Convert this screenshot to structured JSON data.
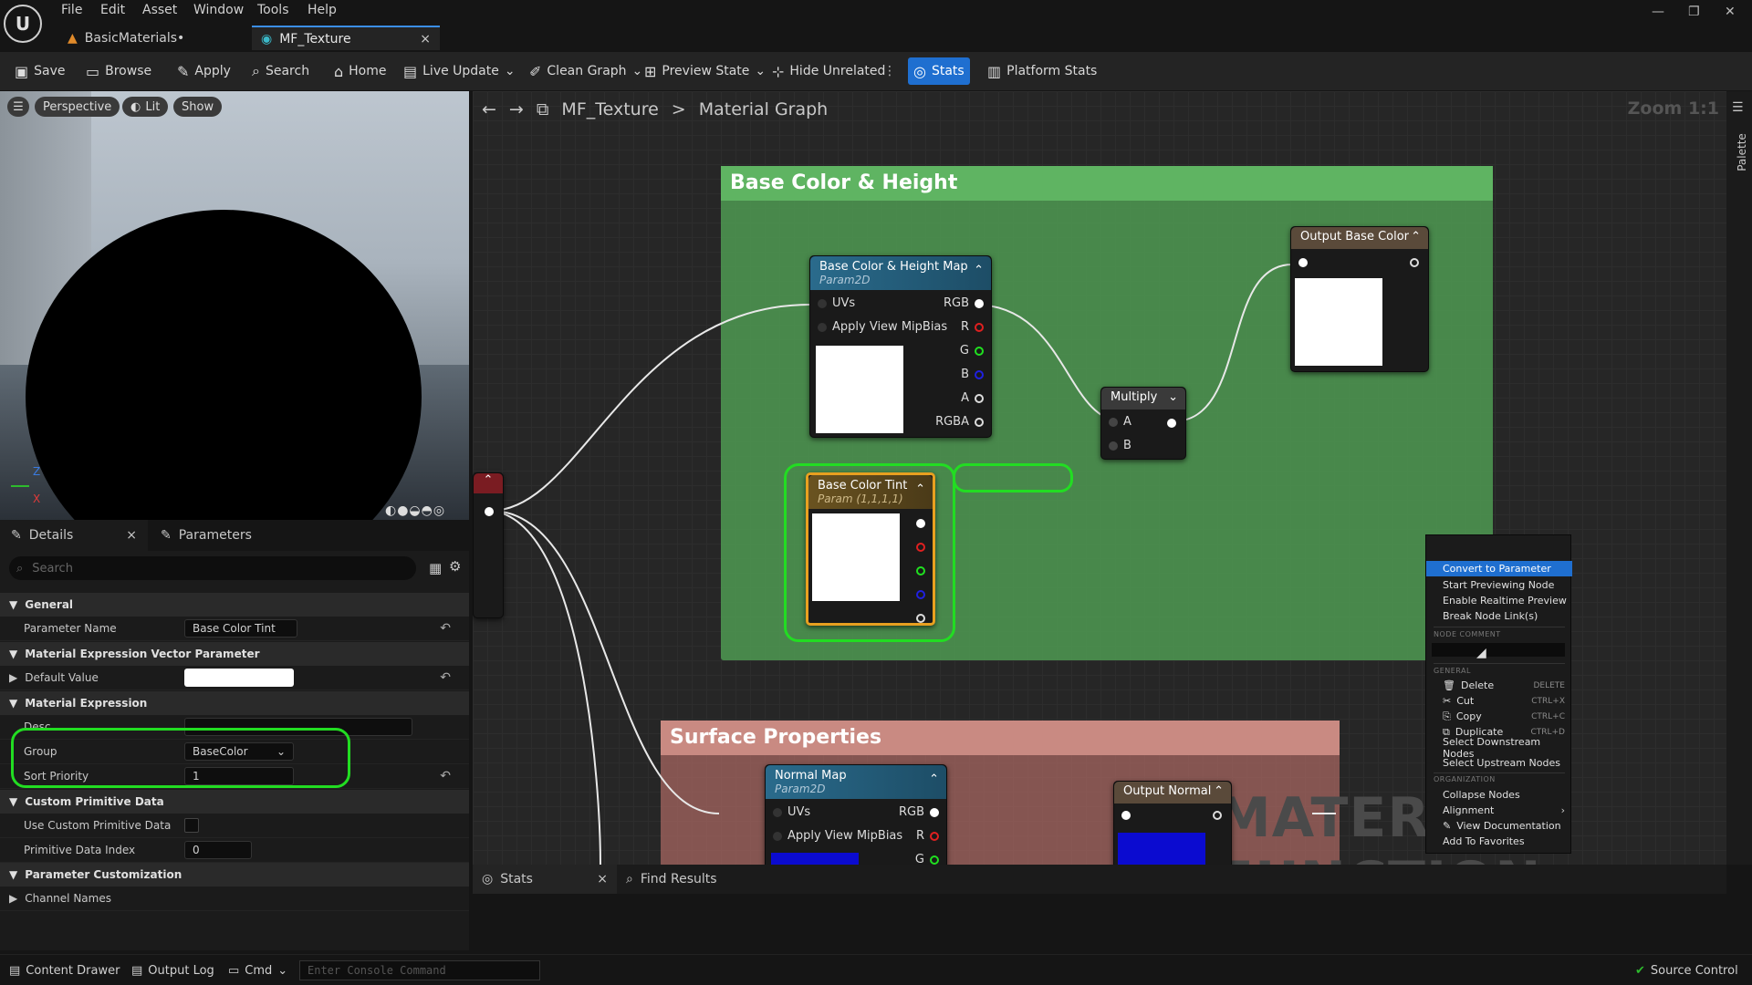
{
  "menu": [
    "File",
    "Edit",
    "Asset",
    "Window",
    "Tools",
    "Help"
  ],
  "tabs": {
    "t1": "BasicMaterials•",
    "t2": "MF_Texture",
    "close": "×"
  },
  "window": {
    "min": "—",
    "max": "❐",
    "close": "✕"
  },
  "toolbar": {
    "save": "Save",
    "browse": "Browse",
    "apply": "Apply",
    "search": "Search",
    "home": "Home",
    "live_update": "Live Update",
    "clean_graph": "Clean Graph",
    "preview_state": "Preview State",
    "hide_unrelated": "Hide Unrelated",
    "stats": "Stats",
    "platform_stats": "Platform Stats"
  },
  "viewport": {
    "perspective": "Perspective",
    "lit": "Lit",
    "show": "Show",
    "axis_z": "Z",
    "axis_x": "X"
  },
  "details": {
    "tab_details": "Details",
    "tab_parameters": "Parameters",
    "search_placeholder": "Search",
    "sec_general": "General",
    "lbl_param_name": "Parameter Name",
    "val_param_name": "Base Color Tint",
    "sec_vector": "Material Expression Vector Parameter",
    "lbl_default": "Default Value",
    "sec_expr": "Material Expression",
    "lbl_desc": "Desc",
    "lbl_group": "Group",
    "val_group": "BaseColor",
    "lbl_sort": "Sort Priority",
    "val_sort": "1",
    "sec_custom": "Custom Primitive Data",
    "lbl_use_custom": "Use Custom Primitive Data",
    "lbl_prim_index": "Primitive Data Index",
    "val_prim_index": "0",
    "sec_custom_param": "Parameter Customization",
    "lbl_channel": "Channel Names"
  },
  "graph": {
    "crumb_asset": "MF_Texture",
    "crumb_sep": ">",
    "crumb_graph": "Material Graph",
    "zoom": "Zoom 1:1",
    "watermark": "MATERIAL FUNCTION",
    "palette": "Palette",
    "comment1": "Base Color & Height",
    "comment1_color": "#4f9a52",
    "comment2": "Surface Properties",
    "comment2_color": "#b86f68"
  },
  "nodes": {
    "bch": {
      "title": "Base Color & Height Map",
      "sub": "Param2D",
      "in_uvs": "UVs",
      "in_mip": "Apply View MipBias",
      "out": [
        "RGB",
        "R",
        "G",
        "B",
        "A",
        "RGBA"
      ]
    },
    "tint": {
      "title": "Base Color Tint",
      "sub": "Param (1,1,1,1)"
    },
    "multiply": {
      "title": "Multiply",
      "a": "A",
      "b": "B"
    },
    "out_bc": {
      "title": "Output Base Color"
    },
    "normal": {
      "title": "Normal Map",
      "sub": "Param2D",
      "in_uvs": "UVs",
      "in_mip": "Apply View MipBias",
      "out": [
        "RGB",
        "R",
        "G"
      ]
    },
    "out_n": {
      "title": "Output Normal"
    }
  },
  "context_menu": {
    "convert": "Convert to Parameter",
    "start_preview": "Start Previewing Node",
    "realtime": "Enable Realtime Preview",
    "break": "Break Node Link(s)",
    "hdr_comment": "NODE COMMENT",
    "hdr_general": "GENERAL",
    "delete": "Delete",
    "delete_sc": "DELETE",
    "cut": "Cut",
    "cut_sc": "CTRL+X",
    "copy": "Copy",
    "copy_sc": "CTRL+C",
    "duplicate": "Duplicate",
    "duplicate_sc": "CTRL+D",
    "sel_down": "Select Downstream Nodes",
    "sel_up": "Select Upstream Nodes",
    "hdr_org": "ORGANIZATION",
    "collapse": "Collapse Nodes",
    "alignment": "Alignment",
    "view_doc": "View Documentation",
    "add_fav": "Add To Favorites"
  },
  "bottom": {
    "stats": "Stats",
    "find": "Find Results"
  },
  "status": {
    "content_drawer": "Content Drawer",
    "output_log": "Output Log",
    "cmd": "Cmd",
    "console_placeholder": "Enter Console Command",
    "source_control": "Source Control"
  },
  "colors": {
    "accent": "#1f6fd0",
    "highlight": "#22dd22",
    "tint_border": "#e8a020"
  }
}
